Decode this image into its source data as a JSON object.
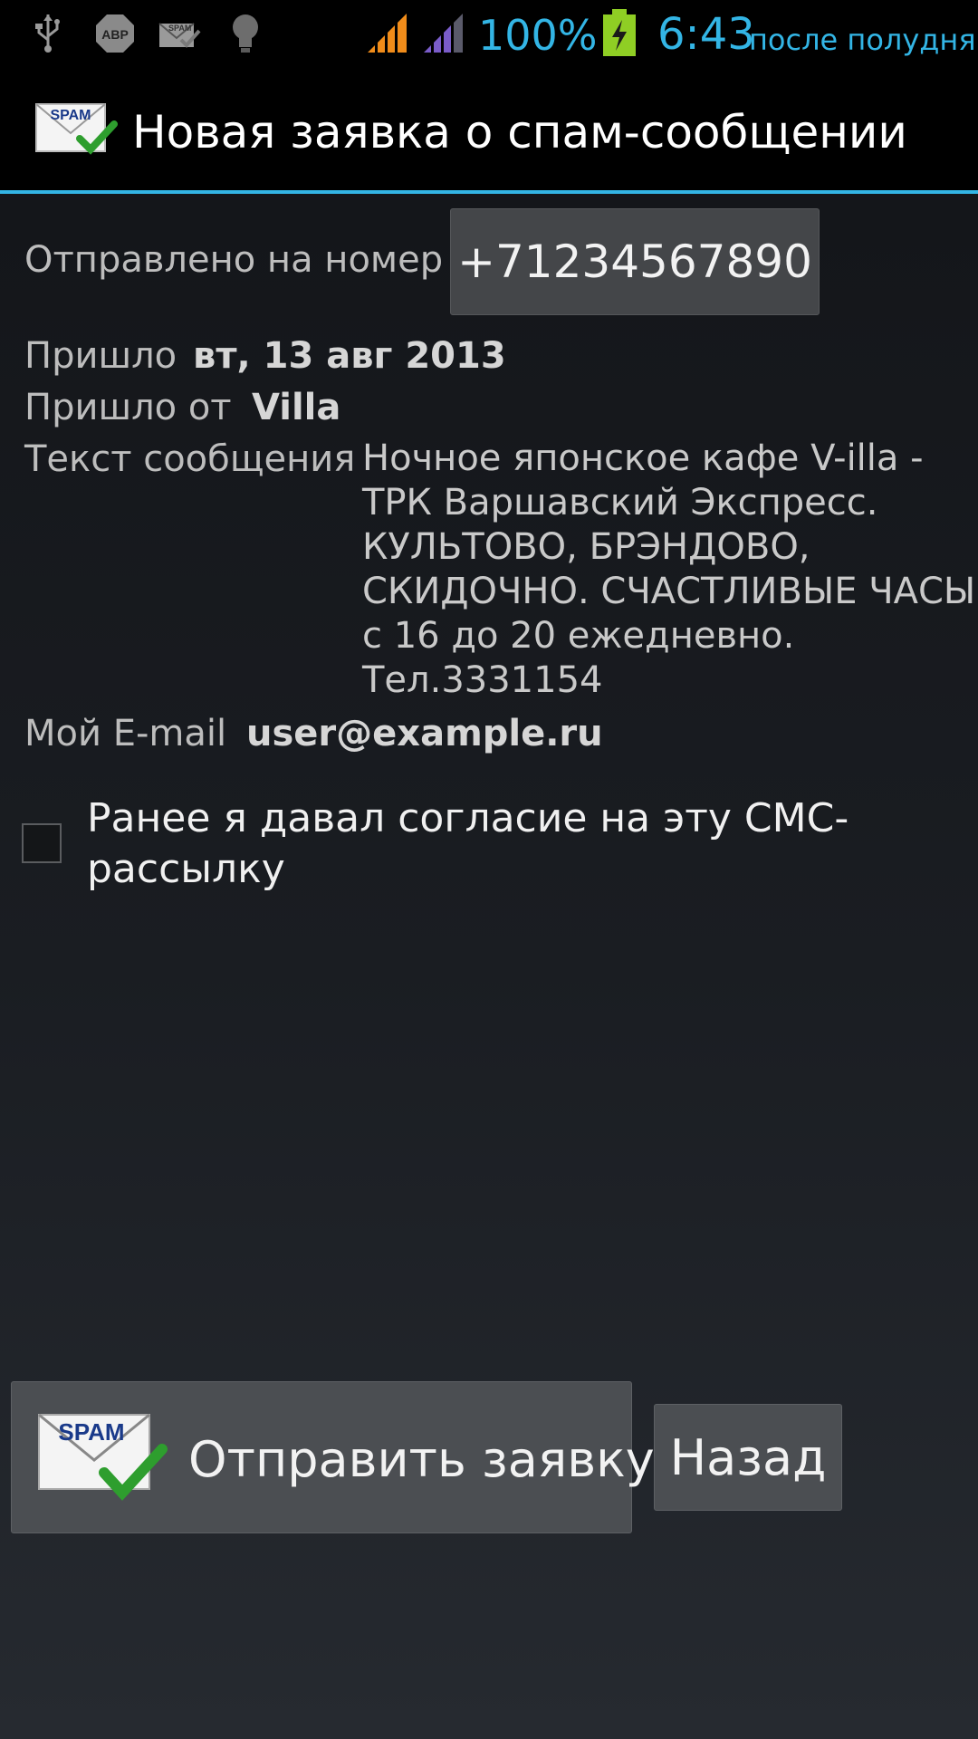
{
  "status_bar": {
    "icons": [
      "usb-icon",
      "adblock-icon",
      "spam-app-icon",
      "lightbulb-icon",
      "cell-signal-icon",
      "cell-signal-2-icon",
      "battery-icon"
    ],
    "adblock_text": "ABP",
    "battery": "100%",
    "time": "6:43",
    "time_suffix": "после полудня",
    "accent_color": "#33b5e5"
  },
  "action_bar": {
    "icon": "spam-envelope-check-icon",
    "icon_badge": "SPAM",
    "title": "Новая заявка о спам-сообщении"
  },
  "form": {
    "sent_to_label": "Отправлено на номер",
    "phone": "+71234567890",
    "received_label": "Пришло",
    "received_date": "вт, 13 авг 2013",
    "from_label": "Пришло от",
    "from_value": "Villa",
    "message_label": "Текст сообщения",
    "message_lines": [
      "Ночное японское кафе V-illa -",
      "ТРК Варшавский Экспресс.",
      "КУЛЬТОВО, БРЭНДОВО,",
      "СКИДОЧНО. СЧАСТЛИВЫЕ ЧАСЫ",
      "с 16 до 20 ежедневно.",
      "Тел.3331154"
    ],
    "email_label": "Мой E-mail",
    "email_value": "user@example.ru",
    "consent_lines": [
      "Ранее я давал согласие на эту СМС-",
      "рассылку"
    ],
    "consent_checked": false
  },
  "buttons": {
    "send_label": "Отправить заявку",
    "send_icon_badge": "SPAM",
    "back_label": "Назад"
  }
}
